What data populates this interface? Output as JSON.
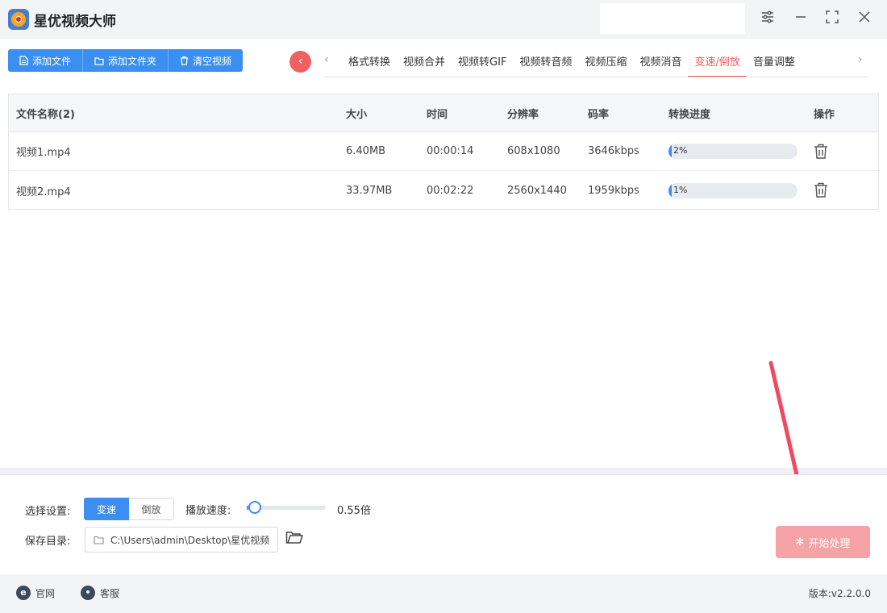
{
  "app": {
    "title": "星优视频大师"
  },
  "toolbar": {
    "add_file": "添加文件",
    "add_folder": "添加文件夹",
    "clear": "清空视频"
  },
  "tabs": [
    "格式转换",
    "视频合并",
    "视频转GIF",
    "视频转音频",
    "视频压缩",
    "视频消音",
    "变速/倒放",
    "音量调整"
  ],
  "active_tab": "变速/倒放",
  "table": {
    "headers": {
      "name": "文件名称(2)",
      "size": "大小",
      "time": "时间",
      "resolution": "分辨率",
      "bitrate": "码率",
      "progress": "转换进度",
      "ops": "操作"
    },
    "rows": [
      {
        "name": "视频1.mp4",
        "size": "6.40MB",
        "time": "00:00:14",
        "resolution": "608x1080",
        "bitrate": "3646kbps",
        "progress_text": "2%",
        "progress": 0.02
      },
      {
        "name": "视频2.mp4",
        "size": "33.97MB",
        "time": "00:02:22",
        "resolution": "2560x1440",
        "bitrate": "1959kbps",
        "progress_text": "1%",
        "progress": 0.01
      }
    ]
  },
  "settings": {
    "select_label": "选择设置:",
    "mode_speed": "变速",
    "mode_reverse": "倒放",
    "speed_label": "播放速度:",
    "speed_value": "0.55倍",
    "speed_level": 0.02,
    "save_label": "保存目录:",
    "save_path": "C:\\Users\\admin\\Desktop\\星优视频",
    "start": "开始处理"
  },
  "statusbar": {
    "site": "官网",
    "service": "客服",
    "version": "版本:v2.2.0.0"
  },
  "colors": {
    "primary": "#3b8ff0",
    "accent": "#f06060",
    "start_disabled": "#f5a3a6"
  }
}
